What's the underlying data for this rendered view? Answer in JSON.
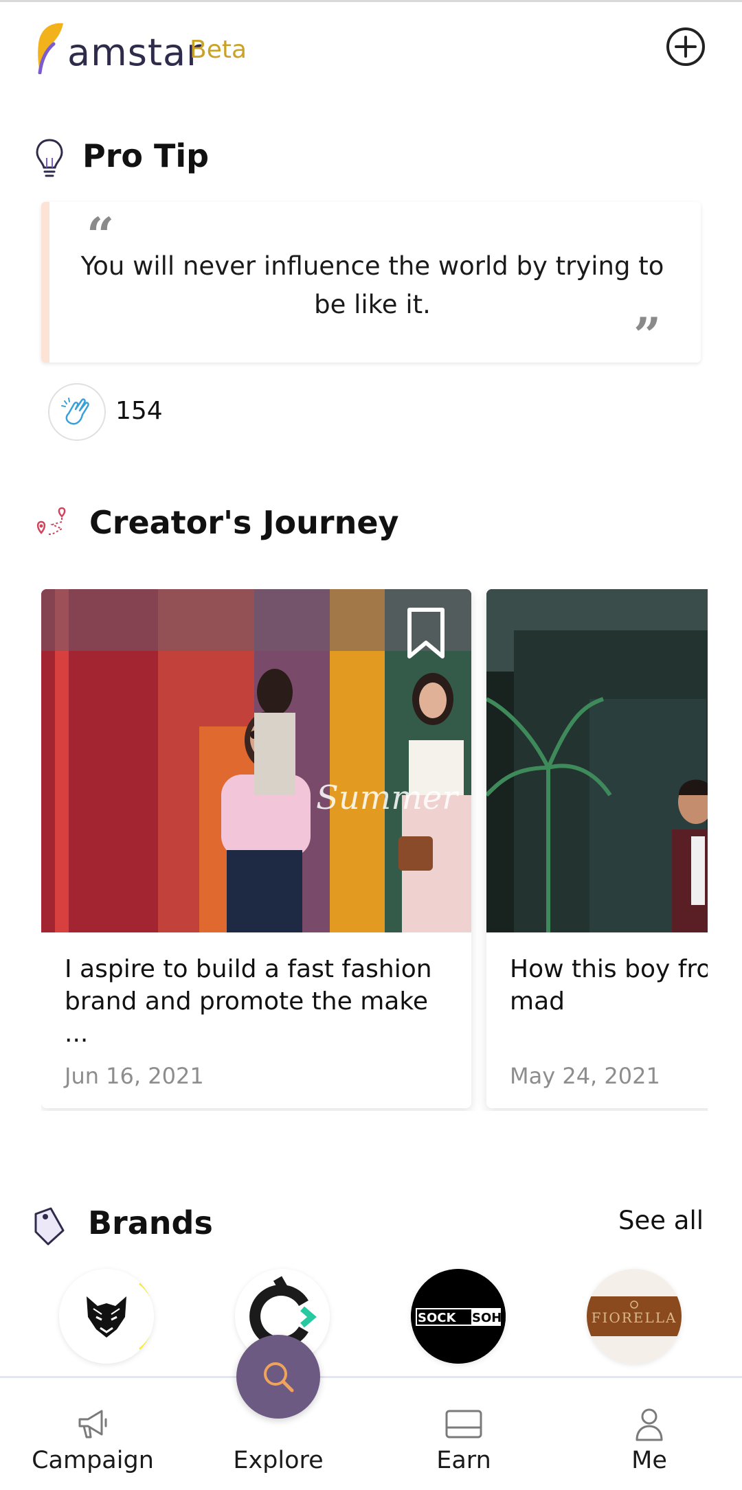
{
  "header": {
    "logo_text": "amstar",
    "beta_label": "Beta",
    "add_icon": "plus-circle-icon"
  },
  "pro_tip": {
    "title": "Pro Tip",
    "quote": "You will never influence the world by trying to be like it.",
    "clap_count": "154"
  },
  "journey": {
    "title": "Creator's Journey",
    "cards": [
      {
        "title": "I aspire to build a fast fashion brand and promote the make ...",
        "date": "Jun 16, 2021"
      },
      {
        "title": "How this boy fro class family mad",
        "date": "May 24, 2021"
      }
    ]
  },
  "brands": {
    "title": "Brands",
    "see_all": "See all",
    "items": [
      {
        "logo": "wolf-logo"
      },
      {
        "logo": "c-arc-logo"
      },
      {
        "logo_text": "SOCKSOHO"
      },
      {
        "logo_text": "FIORELLA"
      }
    ]
  },
  "nav": {
    "items": [
      {
        "label": "Campaign",
        "icon": "megaphone-icon"
      },
      {
        "label": "Explore",
        "icon": "search-icon"
      },
      {
        "label": "Earn",
        "icon": "card-icon"
      },
      {
        "label": "Me",
        "icon": "person-icon"
      }
    ]
  },
  "colors": {
    "brand_dark": "#2f2b4b",
    "beta": "#c9a227",
    "explore_fab": "#6d5a82",
    "tip_accent": "#fde2d6"
  }
}
